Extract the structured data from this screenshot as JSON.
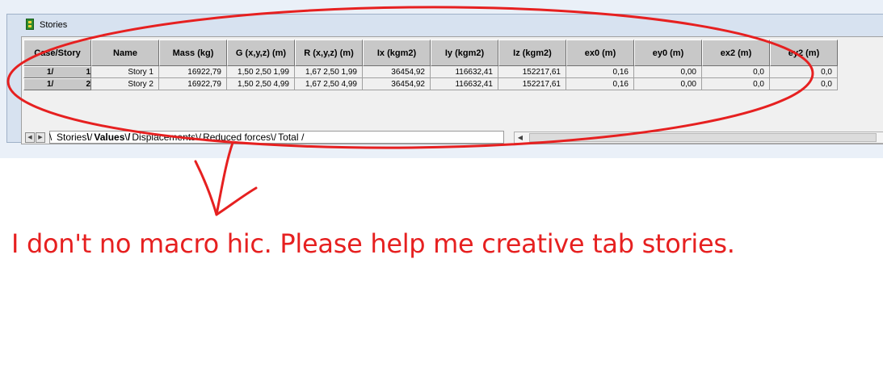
{
  "window": {
    "title": "Stories",
    "icon": "stories-table-icon"
  },
  "table": {
    "headers": [
      "Case/Story",
      "Name",
      "Mass (kg)",
      "G (x,y,z) (m)",
      "R (x,y,z) (m)",
      "Ix (kgm2)",
      "Iy (kgm2)",
      "Iz (kgm2)",
      "ex0 (m)",
      "ey0 (m)",
      "ex2 (m)",
      "ey2 (m)"
    ],
    "rows": [
      {
        "case": "1/",
        "story": "1",
        "name": "Story 1",
        "mass": "16922,79",
        "g": "1,50 2,50 1,99",
        "r": "1,67 2,50 1,99",
        "ix": "36454,92",
        "iy": "116632,41",
        "iz": "152217,61",
        "ex0": "0,16",
        "ey0": "0,00",
        "ex2": "0,0",
        "ey2": "0,0"
      },
      {
        "case": "1/",
        "story": "2",
        "name": "Story 2",
        "mass": "16922,79",
        "g": "1,50 2,50 4,99",
        "r": "1,67 2,50 4,99",
        "ix": "36454,92",
        "iy": "116632,41",
        "iz": "152217,61",
        "ex0": "0,16",
        "ey0": "0,00",
        "ex2": "0,0",
        "ey2": "0,0"
      }
    ]
  },
  "tabs": {
    "items": [
      "Stories",
      "Values",
      "Displacements",
      "Reduced forces",
      "Total"
    ],
    "active": "Values"
  },
  "annotation": {
    "text": "I don't no macro hic. Please help me creative tab stories.",
    "color": "#e62020"
  }
}
